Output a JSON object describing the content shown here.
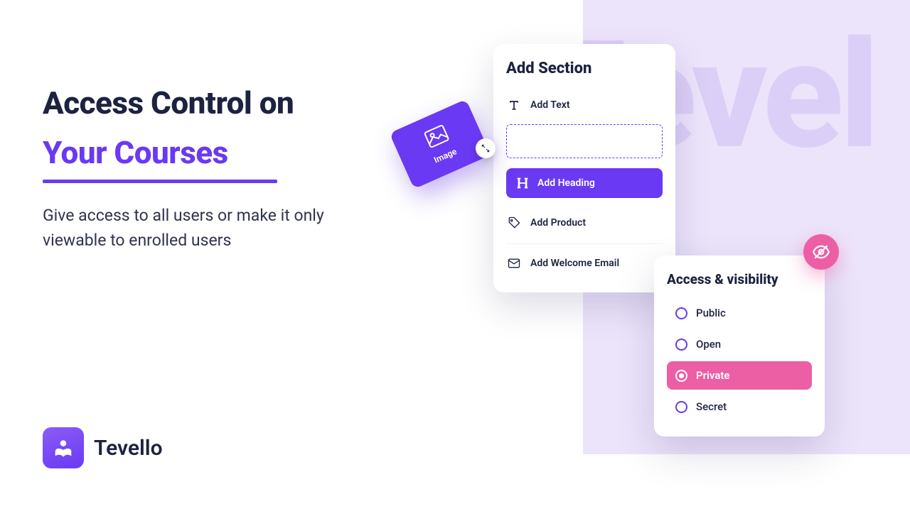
{
  "bg_watermark": "Tevel",
  "headline": {
    "line1": "Access Control on",
    "line2_accent": "Your Courses",
    "sub": "Give access to all users or make it only viewable to enrolled users"
  },
  "brand": {
    "name": "Tevello"
  },
  "add_section": {
    "title": "Add Section",
    "items": {
      "text": "Add Text",
      "heading": "Add Heading",
      "product": "Add Product",
      "welcome": "Add Welcome Email"
    }
  },
  "image_card": {
    "label": "Image"
  },
  "access": {
    "title": "Access & visibility",
    "options": [
      {
        "label": "Public",
        "selected": false
      },
      {
        "label": "Open",
        "selected": false
      },
      {
        "label": "Private",
        "selected": true
      },
      {
        "label": "Secret",
        "selected": false
      }
    ]
  },
  "colors": {
    "accent": "#6A39F3",
    "pink": "#EC5FA4",
    "lavender": "#ECE4FB"
  }
}
